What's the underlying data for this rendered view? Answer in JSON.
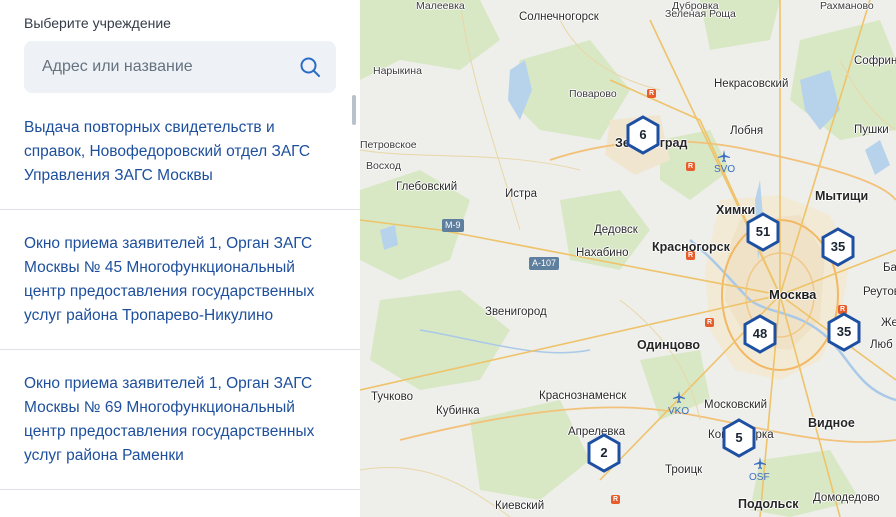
{
  "panel": {
    "label": "Выберите учреждение",
    "search_placeholder": "Адрес или название",
    "results": [
      "Выдача повторных свидетельств и справок, Новофедоровский отдел ЗАГС Управления ЗАГС Москвы",
      "Окно приема заявителей 1, Орган ЗАГС Москвы № 45 Многофункциональный центр предоставления государственных услуг района Тропарево-Никулино",
      "Окно приема заявителей 1, Орган ЗАГС Москвы № 69 Многофункциональный центр предоставления государственных услуг района Раменки"
    ]
  },
  "map": {
    "places": {
      "maleevka": "Малеевка",
      "solnechnogorsk": "Солнечногорск",
      "dubrovka": "Дубровка",
      "zelenaya": "Зеленая Роща",
      "rakhmanovo": "Рахманово",
      "narykina": "Нарыкина",
      "povarovo": "Поварово",
      "nekrasovsky": "Некрасовский",
      "sofrino": "Софрин",
      "lodbya": "Лобня",
      "pushkino": "Пушки",
      "zelenograd": "Зеленоград",
      "svo": "SVO",
      "petrovskoe": "Петровское",
      "voskhod": "Восход",
      "glebovsky": "Глебовский",
      "istra": "Истра",
      "khimki": "Химки",
      "mytishchi": "Мытищи",
      "dedovsk": "Дедовск",
      "krasnogorsk": "Красногорск",
      "nakhabino": "Нахабино",
      "moskva": "Москва",
      "reutov": "Реутов",
      "balashikha": "Ба",
      "zheleznodorozhny": "Же",
      "lyubertsy": "Люб",
      "zvenigorod": "Звенигород",
      "odintsovo": "Одинцово",
      "tuchkovo": "Тучково",
      "kubinka": "Кубинка",
      "krasnoznamensk": "Краснознаменск",
      "vko": "VKO",
      "moskovsky": "Московский",
      "vidnoe": "Видное",
      "aprelevka": "Апрелевка",
      "kommunarka": "Коммунарка",
      "troitsk": "Троицк",
      "osf": "OSF",
      "podolsk": "Подольск",
      "domodedovo": "Домодедово",
      "kievsky": "Киевский"
    },
    "roads": {
      "m9": "М-9",
      "a107": "А-107"
    },
    "clusters": [
      "6",
      "51",
      "35",
      "48",
      "35",
      "5",
      "2"
    ]
  }
}
